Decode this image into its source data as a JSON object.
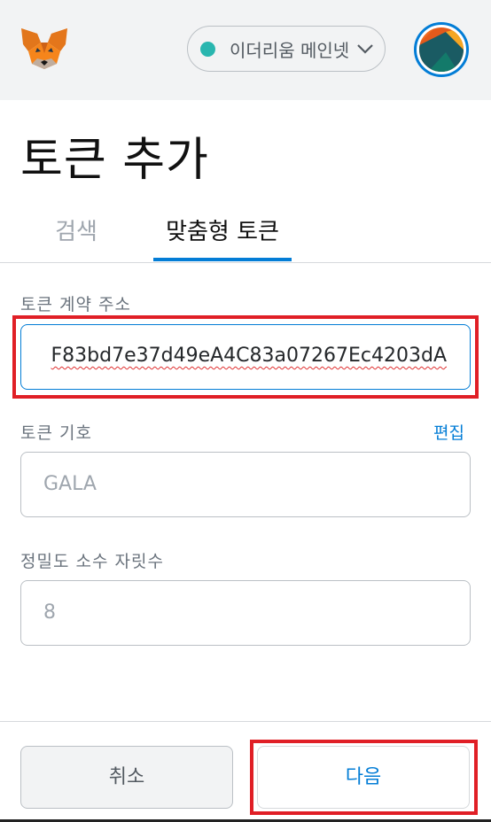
{
  "header": {
    "network": {
      "label": "이더리움 메인넷",
      "dot_color": "#29b6af"
    }
  },
  "page": {
    "title": "토큰 추가"
  },
  "tabs": [
    {
      "label": "검색",
      "active": false
    },
    {
      "label": "맞춤형 토큰",
      "active": true
    }
  ],
  "form": {
    "address": {
      "label": "토큰 계약 주소",
      "value": "F83bd7e37d49eA4C83a07267Ec4203dA"
    },
    "symbol": {
      "label": "토큰 기호",
      "edit_label": "편집",
      "value": "GALA"
    },
    "decimals": {
      "label": "정밀도 소수 자릿수",
      "value": "8"
    }
  },
  "footer": {
    "cancel_label": "취소",
    "next_label": "다음"
  },
  "colors": {
    "accent": "#037dd6",
    "highlight": "#e01f26",
    "header_bg": "#f2f3f4"
  },
  "icons": {
    "logo": "metamask-fox-icon",
    "network_chevron": "chevron-down-icon",
    "account": "account-avatar-icon"
  }
}
